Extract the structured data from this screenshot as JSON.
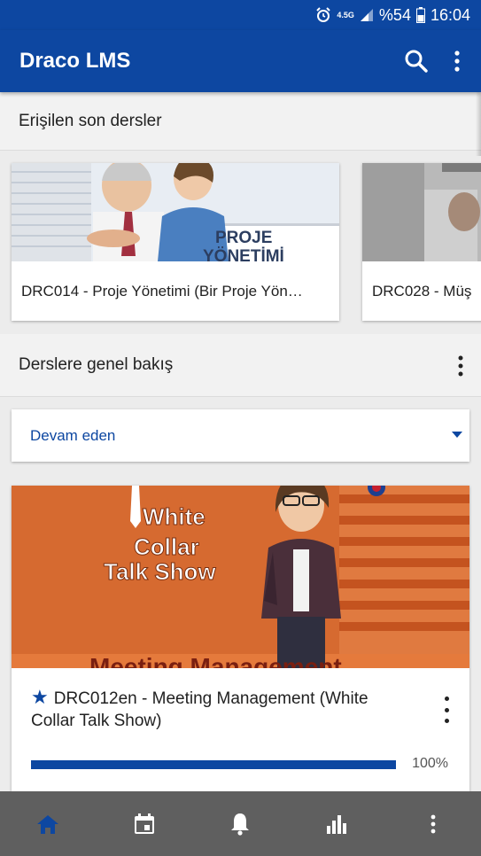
{
  "status_bar": {
    "network": "4.5G",
    "battery": "%54",
    "time": "16:04"
  },
  "app_bar": {
    "title": "Draco LMS"
  },
  "recent": {
    "heading": "Erişilen son dersler",
    "courses": [
      {
        "title": "DRC014 - Proje Yönetimi (Bir Proje Yön…",
        "image_text_line1": "PROJE",
        "image_text_line2": "YÖNETİMİ"
      },
      {
        "title": "DRC028 - Müş"
      }
    ]
  },
  "overview": {
    "heading": "Derslere genel bakış",
    "filter_value": "Devam eden"
  },
  "course": {
    "image_lines": [
      "White",
      "Collar",
      "Talk Show"
    ],
    "image_bottom_text": "Meeting Management",
    "title": "DRC012en - Meeting Management (White Collar Talk Show)",
    "progress": 100,
    "progress_text": "100%"
  },
  "bottom_nav": [
    {
      "icon": "home-icon",
      "active": true
    },
    {
      "icon": "calendar-icon",
      "active": false
    },
    {
      "icon": "bell-icon",
      "active": false
    },
    {
      "icon": "bar-chart-icon",
      "active": false
    },
    {
      "icon": "more-vertical-icon",
      "active": false
    }
  ],
  "colors": {
    "primary": "#0d47a1",
    "bottom_nav_bg": "#5f5f5f"
  }
}
